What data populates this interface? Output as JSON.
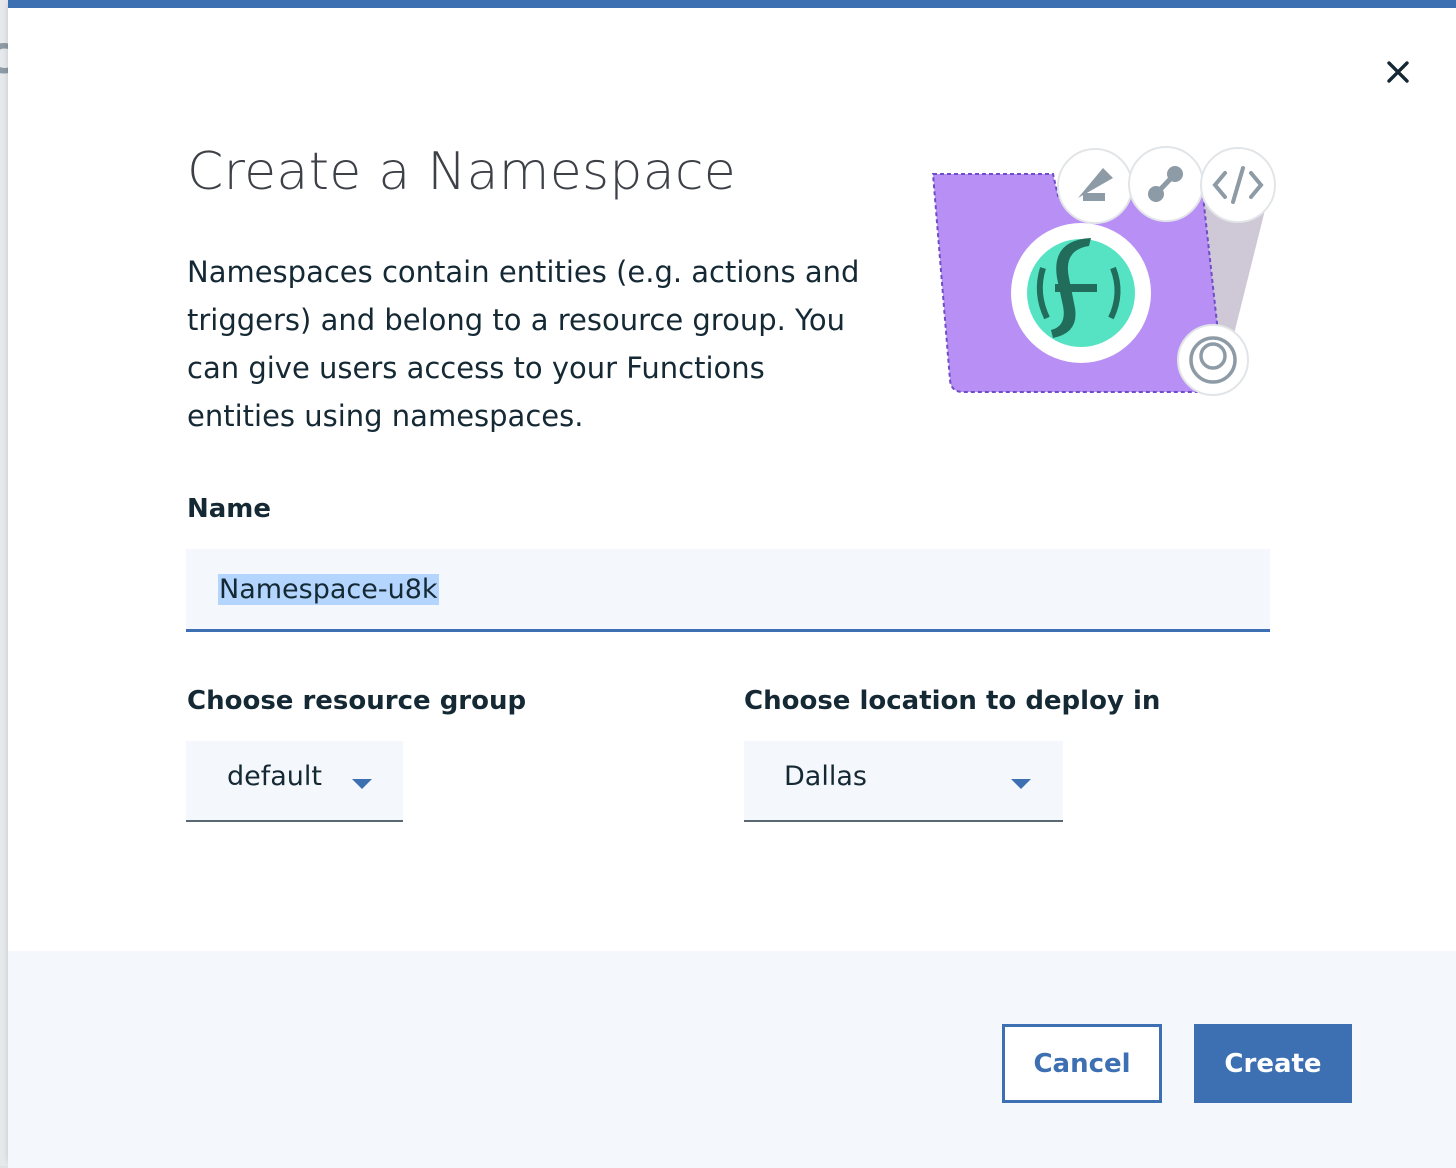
{
  "modal": {
    "title": "Create a Namespace",
    "description": "Namespaces contain entities (e.g. actions and triggers) and belong to a resource group. You can give users access to your Functions entities using namespaces.",
    "close_icon": "close-icon"
  },
  "form": {
    "name_label": "Name",
    "name_value": "Namespace-u8k",
    "resource_group_label": "Choose resource group",
    "resource_group_value": "default",
    "location_label": "Choose location to deploy in",
    "location_value": "Dallas"
  },
  "footer": {
    "cancel_label": "Cancel",
    "create_label": "Create"
  },
  "illustration": {
    "icons": [
      "folder-icon",
      "functions-logo-icon",
      "satellite-icon",
      "share-icon",
      "code-icon",
      "user-icon"
    ]
  },
  "colors": {
    "accent": "#3d70b2",
    "folder": "#b88ff5",
    "logo_teal": "#56e3c4",
    "logo_dark": "#216c5a"
  }
}
